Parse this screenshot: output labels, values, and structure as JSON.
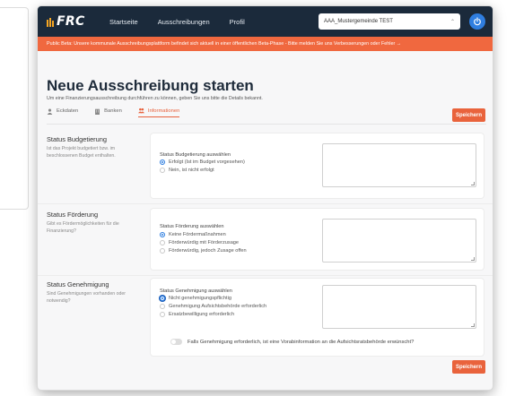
{
  "nav": {
    "logo": "FRC",
    "links": [
      "Startseite",
      "Ausschreibungen",
      "Profil"
    ],
    "org_select": "AAA_Mustergemeinde TEST"
  },
  "banner": "Public Beta: Unsere kommunale Ausschreibungsplattform befindet sich aktuell in einer öffentlichen Beta-Phase - Bitte melden Sie uns Verbesserungen oder Fehler →",
  "page": {
    "title": "Neue Ausschreibung starten",
    "subtitle": "Um eine Finanzierungsausschreibung durchführen zu können, geben Sie uns bitte die Details bekannt.",
    "save_label": "Speichern"
  },
  "tabs": [
    {
      "label": "Eckdaten",
      "icon": "user-icon"
    },
    {
      "label": "Banken",
      "icon": "building-icon"
    },
    {
      "label": "Informationen",
      "icon": "users-icon",
      "active": true
    }
  ],
  "sections": {
    "budget": {
      "heading": "Status Budgetierung",
      "description": "Ist das Projekt budgetiert bzw. im beschlossenen Budget enthalten.",
      "question": "Status Budgetierung auswählen",
      "options": [
        "Erfolgt (Ist im Budget vorgesehen)",
        "Nein, ist nicht erfolgt"
      ]
    },
    "funding": {
      "heading": "Status Förderung",
      "description": "Gibt es Fördermöglichkeiten für die Finanzierung?",
      "question": "Status Förderung auswählen",
      "options": [
        "Keine Fördermaßnahmen",
        "Förderwürdig mit Förderzusage",
        "Förderwürdig, jedoch Zusage offen"
      ]
    },
    "approval": {
      "heading": "Status Genehmigung",
      "description": "Sind Genehmigungen vorhanden oder notwendig?",
      "question": "Status Genehmigung auswählen",
      "options": [
        "Nicht genehmigungspflichtig",
        "Genehmigung Aufsichtsbehörde erforderlich",
        "Ersatzbewilligung erforderlich"
      ],
      "toggle_label": "Falls Genehmigung erforderlich, ist eine Vorabinformation an die Aufsichtsratsbehörde erwünscht?"
    }
  },
  "colors": {
    "accent": "#e9633c",
    "nav": "#1b2a3b",
    "primary": "#2f7ee0"
  }
}
